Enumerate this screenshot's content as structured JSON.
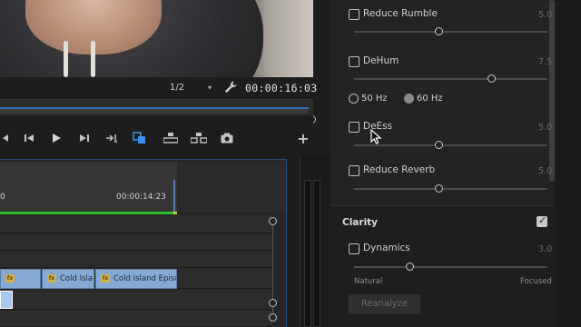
{
  "monitor": {
    "resolution": "1/2",
    "resolution_options_caret": "▾",
    "timecode": "00:00:16:03"
  },
  "timeline": {
    "ruler_start_label": "0",
    "ruler_timecode": "00:00:14:23",
    "clips": [
      {
        "label": "",
        "fx": "fx"
      },
      {
        "label": "Cold Isla",
        "fx": "fx"
      },
      {
        "label": "Cold Island Episod",
        "fx": "fx"
      }
    ],
    "add_button": "+"
  },
  "essential_sound": {
    "reduce_rumble": {
      "label": "Reduce Rumble",
      "value": "5.0",
      "checked": false,
      "level": 0.44
    },
    "dehum": {
      "label": "DeHum",
      "value": "7.5",
      "checked": false,
      "level": 0.71
    },
    "hz_options": [
      {
        "label": "50 Hz",
        "selected": false
      },
      {
        "label": "60 Hz",
        "selected": true
      }
    ],
    "deess": {
      "label": "DeEss",
      "value": "5.0",
      "checked": false,
      "level": 0.44
    },
    "reduce_reverb": {
      "label": "Reduce Reverb",
      "value": "5.0",
      "checked": false,
      "level": 0.44
    },
    "clarity": {
      "title": "Clarity",
      "checked": true,
      "dynamics": {
        "label": "Dynamics",
        "value": "3.0",
        "checked": false,
        "level": 0.29
      },
      "scale_left": "Natural",
      "scale_right": "Focused",
      "reanalyze_label": "Reanalyze"
    }
  },
  "colors": {
    "accent_blue": "#2f6fb8",
    "playhead_green": "#2ec02e",
    "clip_blue": "#86a9d4"
  }
}
